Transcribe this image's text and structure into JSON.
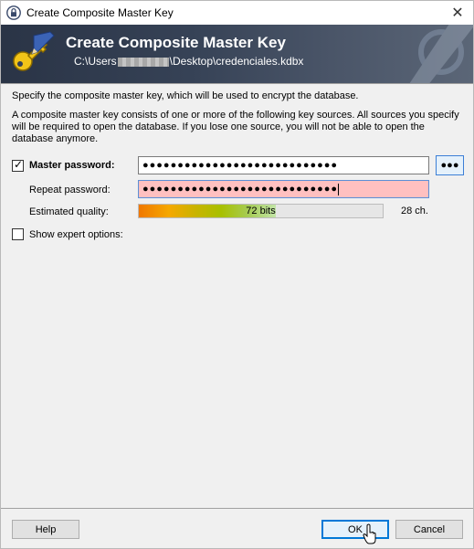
{
  "window": {
    "title": "Create Composite Master Key",
    "close_glyph": "✕"
  },
  "banner": {
    "title": "Create Composite Master Key",
    "path_prefix": "C:\\Users",
    "path_suffix": "\\Desktop\\credenciales.kdbx",
    "icon": "key-pencil-icon"
  },
  "intro": {
    "line1": "Specify the composite master key, which will be used to encrypt the database.",
    "line2": "A composite master key consists of one or more of the following key sources. All sources you specify will be required to open the database. If you lose one source, you will not be able to open the database anymore."
  },
  "form": {
    "master_password_label": "Master password:",
    "master_password_checked": true,
    "master_password_value": "●●●●●●●●●●●●●●●●●●●●●●●●●●●●",
    "reveal_button_label": "●●●",
    "repeat_password_label": "Repeat password:",
    "repeat_password_value": "●●●●●●●●●●●●●●●●●●●●●●●●●●●●",
    "repeat_field_color": "#ffc0c0",
    "estimated_quality_label": "Estimated quality:",
    "quality_text": "72 bits",
    "quality_fraction": 0.56,
    "char_count": "28 ch.",
    "expert_options_label": "Show expert options:",
    "expert_options_checked": false
  },
  "buttons": {
    "help": "Help",
    "ok": "OK",
    "cancel": "Cancel"
  }
}
